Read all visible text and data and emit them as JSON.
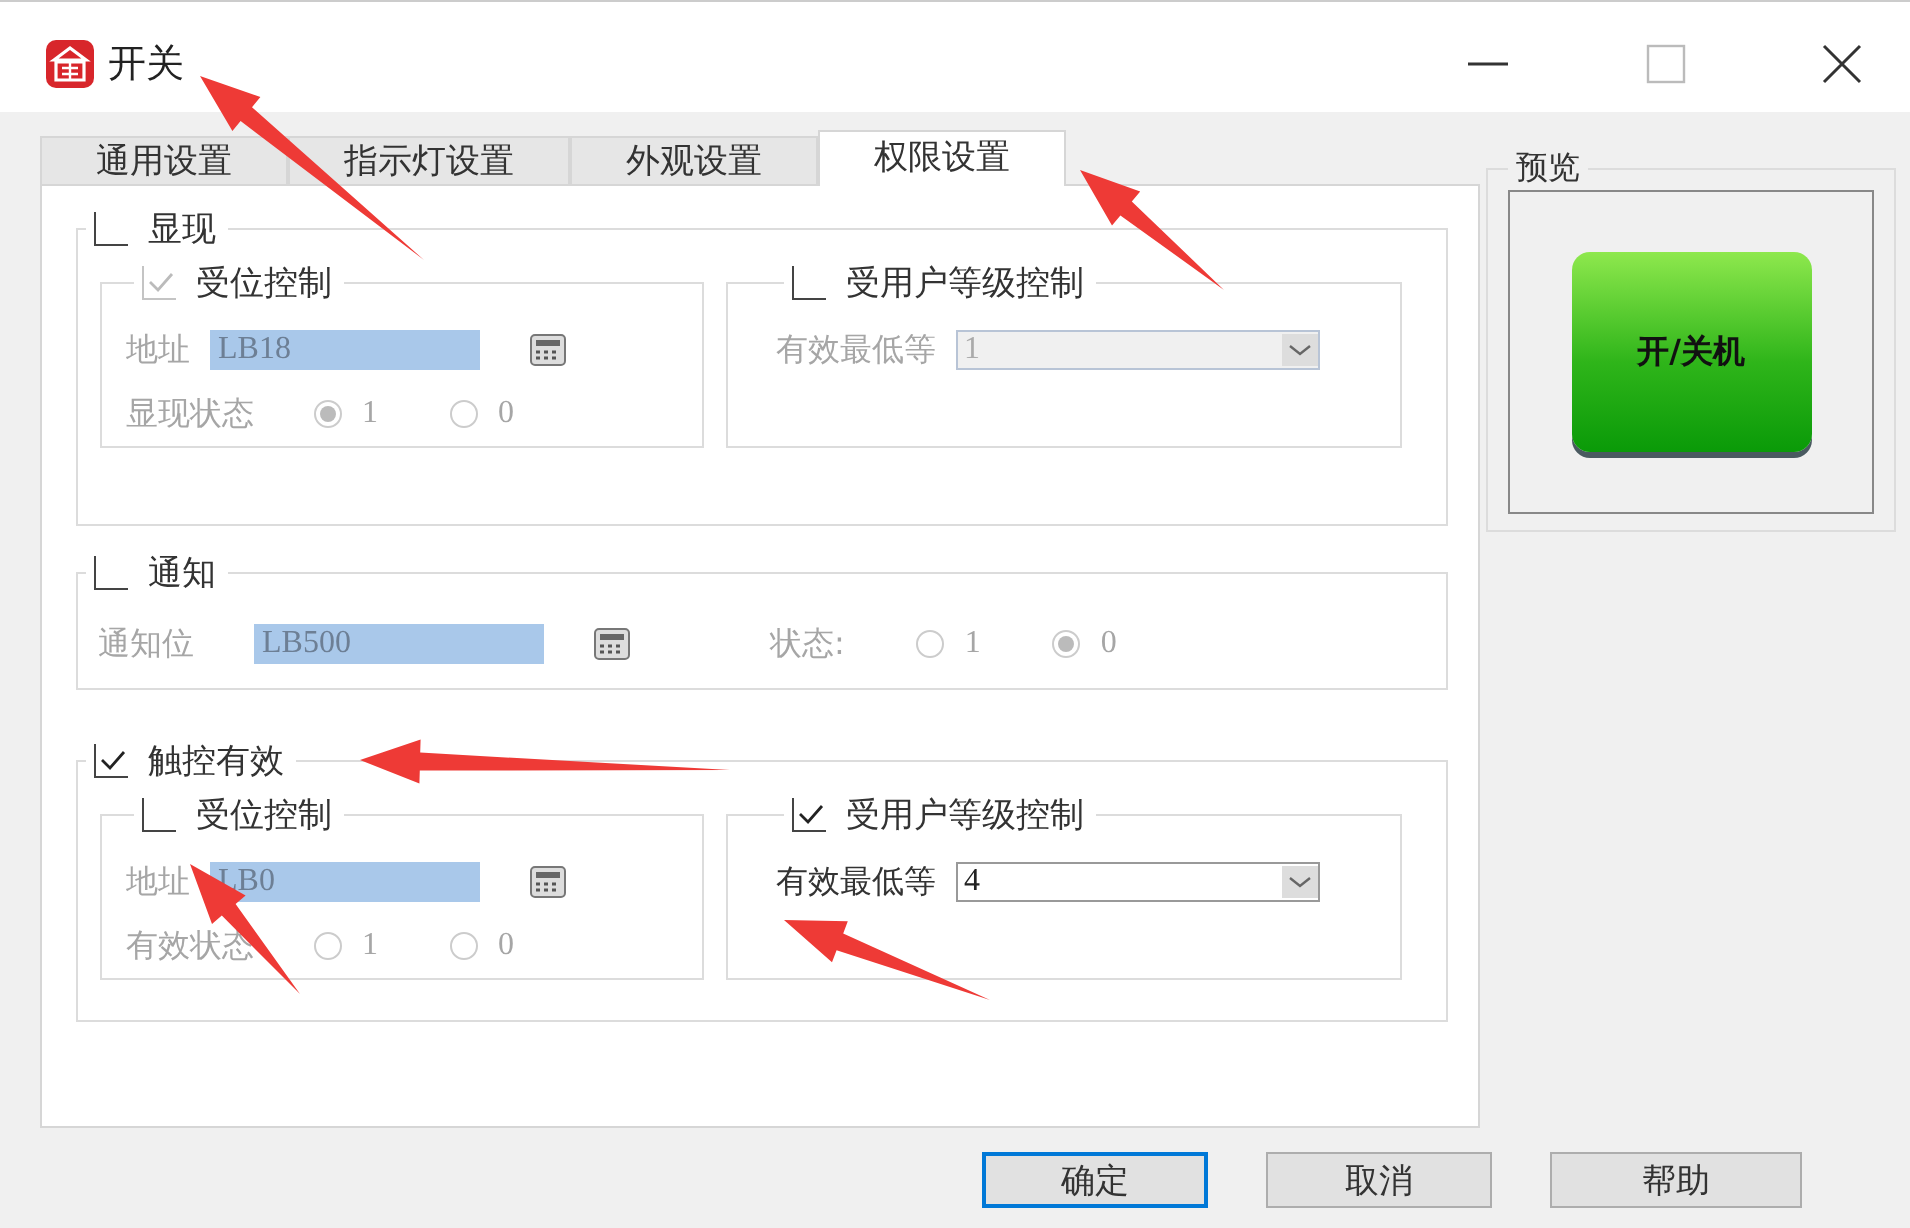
{
  "window": {
    "title": "开关"
  },
  "tabs": [
    {
      "label": "通用设置",
      "selected": false
    },
    {
      "label": "指示灯设置",
      "selected": false
    },
    {
      "label": "外观设置",
      "selected": false
    },
    {
      "label": "权限设置",
      "selected": true
    }
  ],
  "sections": [
    {
      "kind": "display",
      "title": "显现",
      "checked": false,
      "groups": [
        {
          "kind": "bit",
          "title": "受位控制",
          "checked": true,
          "disabled": true,
          "address_label": "地址",
          "address": "LB18",
          "state_label": "显现状态",
          "options": [
            {
              "label": "1",
              "selected": true
            },
            {
              "label": "0",
              "selected": false
            }
          ]
        },
        {
          "kind": "level",
          "title": "受用户等级控制",
          "checked": false,
          "disabled": true,
          "level_label": "有效最低等",
          "value": "1"
        }
      ]
    },
    {
      "kind": "notify",
      "title": "通知",
      "checked": false,
      "bit_label": "通知位",
      "address": "LB500",
      "state_label": "状态:",
      "options": [
        {
          "label": "1",
          "selected": false
        },
        {
          "label": "0",
          "selected": true
        }
      ]
    },
    {
      "kind": "touch",
      "title": "触控有效",
      "checked": true,
      "groups": [
        {
          "kind": "bit",
          "title": "受位控制",
          "checked": false,
          "disabled": true,
          "address_label": "地址",
          "address": "LB0",
          "state_label": "有效状态",
          "options": [
            {
              "label": "1",
              "selected": false
            },
            {
              "label": "0",
              "selected": false
            }
          ]
        },
        {
          "kind": "level",
          "title": "受用户等级控制",
          "checked": true,
          "disabled": false,
          "level_label": "有效最低等",
          "value": "4"
        }
      ]
    }
  ],
  "preview": {
    "title": "预览",
    "button_label": "开/关机"
  },
  "buttons": [
    {
      "label": "确定",
      "selected": true
    },
    {
      "label": "取消",
      "selected": false
    },
    {
      "label": "帮助",
      "selected": false
    }
  ]
}
